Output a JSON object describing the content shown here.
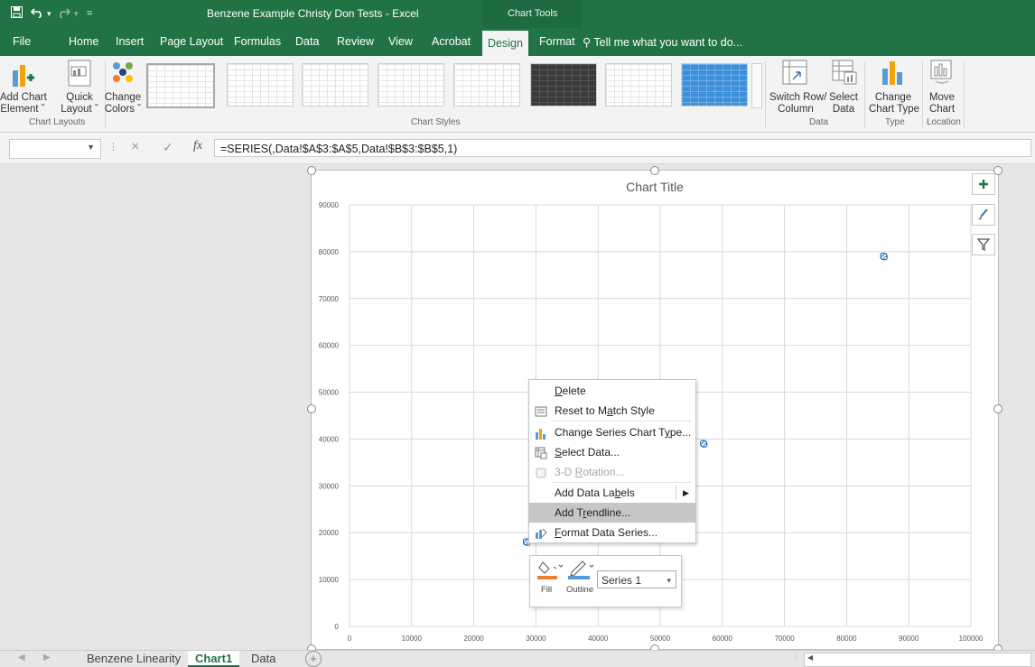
{
  "window": {
    "title": "Benzene Example Christy Don Tests - Excel",
    "contextual_tab_group": "Chart Tools",
    "qat": {
      "save_icon": "floppy-icon",
      "undo_icon": "undo-arrow-icon",
      "redo_icon": "redo-arrow-icon",
      "customize": "="
    }
  },
  "ribbon": {
    "tabs": [
      "File",
      "Home",
      "Insert",
      "Page Layout",
      "Formulas",
      "Data",
      "Review",
      "View",
      "Acrobat",
      "Design",
      "Format"
    ],
    "active_tab": "Design",
    "tell_me": "Tell me what you want to do...",
    "groups": {
      "chart_layouts": {
        "label": "Chart Layouts",
        "add_chart_element": [
          "Add Chart",
          "Element ˇ"
        ],
        "quick_layout": [
          "Quick",
          "Layout ˇ"
        ]
      },
      "colors": {
        "change_colors": [
          "Change",
          "Colors ˇ"
        ]
      },
      "chart_styles": {
        "label": "Chart Styles"
      },
      "data": {
        "label": "Data",
        "switch_row_column": [
          "Switch Row/",
          "Column"
        ],
        "select_data": [
          "Select",
          "Data"
        ]
      },
      "type": {
        "label": "Type",
        "change_chart_type": [
          "Change",
          "Chart Type"
        ]
      },
      "location": {
        "label": "Location",
        "move_chart": [
          "Move",
          "Chart"
        ]
      }
    }
  },
  "formula_bar": {
    "name_box": "",
    "fx": "fx",
    "cancel": "×",
    "enter": "✓",
    "formula": "=SERIES(,Data!$A$3:$A$5,Data!$B$3:$B$5,1)"
  },
  "chart_data": {
    "type": "scatter",
    "title": "Chart Title",
    "xlabel": "",
    "ylabel": "",
    "xlim": [
      0,
      100000
    ],
    "ylim": [
      0,
      90000
    ],
    "x_ticks": [
      0,
      10000,
      20000,
      30000,
      40000,
      50000,
      60000,
      70000,
      80000,
      90000,
      100000
    ],
    "y_ticks": [
      0,
      10000,
      20000,
      30000,
      40000,
      50000,
      60000,
      70000,
      80000,
      90000
    ],
    "grid": true,
    "series": [
      {
        "name": "Series 1",
        "color": "#2e75b6",
        "points": [
          [
            28500,
            18000
          ],
          [
            57000,
            39000
          ],
          [
            86000,
            79000
          ]
        ]
      }
    ]
  },
  "chart_side_buttons": [
    "plus-icon",
    "brush-icon",
    "filter-icon"
  ],
  "context_menu": {
    "items": [
      {
        "label": "Delete",
        "icon": "",
        "enabled": true
      },
      {
        "label": "Reset to Match Style",
        "icon": "reset-style-icon",
        "enabled": true
      },
      {
        "label": "Change Series Chart Type...",
        "icon": "bar-chart-icon",
        "enabled": true
      },
      {
        "label": "Select Data...",
        "icon": "select-data-icon",
        "enabled": true
      },
      {
        "label": "3-D Rotation...",
        "icon": "cube-icon",
        "enabled": false
      },
      {
        "label": "Add Data Labels",
        "icon": "",
        "enabled": true,
        "submenu": true
      },
      {
        "label": "Add Trendline...",
        "icon": "",
        "enabled": true,
        "highlighted": true
      },
      {
        "label": "Format Data Series...",
        "icon": "format-series-icon",
        "enabled": true
      }
    ]
  },
  "mini_toolbar": {
    "fill_label": "Fill",
    "outline_label": "Outline",
    "series_value": "Series 1",
    "fill_color": "#ed7d31",
    "outline_color": "#5b9bd5"
  },
  "sheets": {
    "tabs": [
      "Benzene Linearity",
      "Chart1",
      "Data"
    ],
    "active": "Chart1",
    "add_label": "+"
  }
}
